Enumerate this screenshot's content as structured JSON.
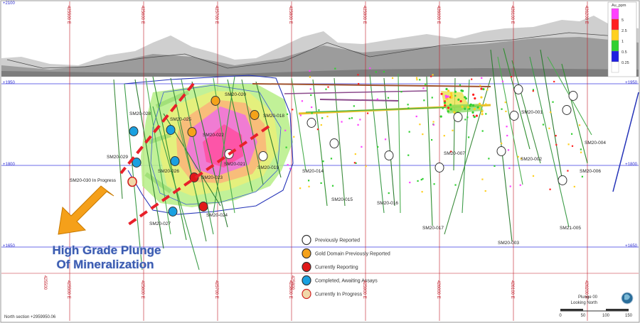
{
  "annotations": {
    "title_line1": "High Grade Plunge",
    "title_line2": "Of Mineralization",
    "in_progress_hole": "SM20-030 In Progress"
  },
  "easting_labels": [
    "425500 E",
    "425600 E",
    "425700 E",
    "425800 E",
    "425900 E",
    "426000 E",
    "426100 E",
    "426200 E",
    "426300 E",
    "426400 E",
    "426500 E"
  ],
  "elevation_labels": [
    "+2100",
    "+1950",
    "+1800",
    "+1650"
  ],
  "elevation_labels_right": [
    "+2100",
    "+1950",
    "+1800",
    "+1650"
  ],
  "bottom_easting_labels": [
    "425500",
    "425600",
    "425700",
    "425800",
    "425900",
    "426000",
    "426100",
    "426200",
    "426300",
    "426400",
    "426500"
  ],
  "hole_labels": [
    "SM20-020",
    "SM20-018",
    "SM20-028",
    "SM20-025",
    "SM20-022",
    "SM20-029",
    "SM20-021",
    "SM20-026",
    "SM20-023",
    "SM20-019",
    "SM20-014",
    "SM20-015",
    "SM20-016",
    "SM20-024",
    "SM20-027",
    "SM20-017",
    "SM20-007",
    "SM20-001",
    "SM20-002",
    "SM20-003",
    "SM20-004",
    "SM20-006",
    "SM21-005"
  ],
  "legend": [
    {
      "label": "Previously Reported",
      "color": "#ffffff",
      "stroke": "#333333"
    },
    {
      "label": "Gold Domain Previously Reported",
      "color": "#f5a21a",
      "stroke": "#333333"
    },
    {
      "label": "Currently Reporting",
      "color": "#e01818",
      "stroke": "#333333"
    },
    {
      "label": "Completed, Awaiting Assays",
      "color": "#1aa0e0",
      "stroke": "#333333"
    },
    {
      "label": "Currently In Progress",
      "color": "#f0d8a8",
      "stroke": "#d02020"
    }
  ],
  "grade_legend": {
    "title": "Au_ppm",
    "entries": [
      {
        "label": "5",
        "color": "#ff40ff"
      },
      {
        "label": "2.5",
        "color": "#ff2020"
      },
      {
        "label": "1",
        "color": "#ffd020"
      },
      {
        "label": "0.5",
        "color": "#30d030"
      },
      {
        "label": "0.25",
        "color": "#2020e0"
      },
      {
        "label": "",
        "color": "#ffffff"
      }
    ]
  },
  "footer": {
    "section_caption": "North section +2959950.06"
  },
  "view": {
    "plunge": "Plunge 00",
    "looking": "Looking North"
  },
  "scale_bar": {
    "ticks": [
      "0",
      "50",
      "100",
      "150"
    ]
  },
  "colors": {
    "previously_reported": "#ffffff",
    "gold_domain": "#f5a21a",
    "currently_reporting": "#e01818",
    "awaiting_assays": "#1aa0e0",
    "in_progress": "#f0d8a8"
  }
}
